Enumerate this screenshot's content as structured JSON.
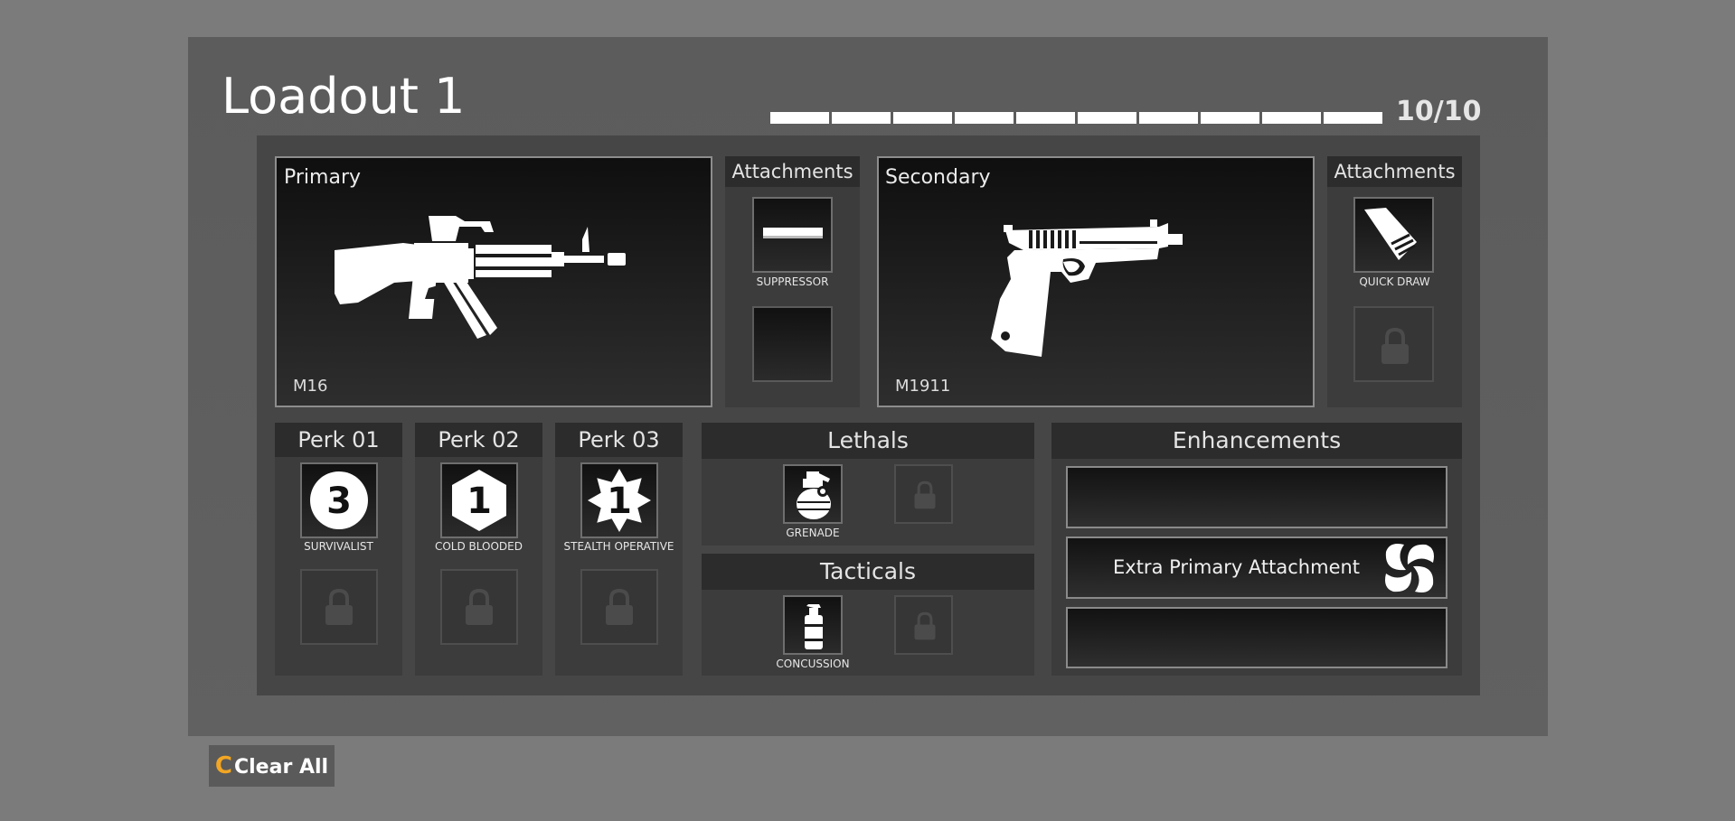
{
  "loadout": {
    "title": "Loadout 1",
    "points_used": 10,
    "points_max": 10,
    "points_label": "10/10"
  },
  "primary": {
    "label": "Primary",
    "weapon": "M16",
    "icon": "assault-rifle-icon",
    "attachments_header": "Attachments",
    "attachments": [
      {
        "name": "SUPPRESSOR",
        "icon": "suppressor-icon"
      },
      {
        "name": "",
        "icon": ""
      }
    ]
  },
  "secondary": {
    "label": "Secondary",
    "weapon": "M1911",
    "icon": "pistol-icon",
    "attachments_header": "Attachments",
    "attachments": [
      {
        "name": "QUICK DRAW",
        "icon": "quick-draw-icon"
      },
      {
        "name": "",
        "icon": "lock-icon",
        "locked": true
      }
    ]
  },
  "perks": [
    {
      "header": "Perk 01",
      "name": "SURVIVALIST",
      "badge": "3",
      "icon": "survivalist-icon"
    },
    {
      "header": "Perk 02",
      "name": "COLD BLOODED",
      "badge": "1",
      "icon": "cold-blooded-icon"
    },
    {
      "header": "Perk 03",
      "name": "STEALTH OPERATIVE",
      "badge": "1",
      "icon": "stealth-operative-icon"
    }
  ],
  "lethals": {
    "header": "Lethals",
    "items": [
      {
        "name": "GRENADE",
        "icon": "grenade-icon"
      }
    ]
  },
  "tacticals": {
    "header": "Tacticals",
    "items": [
      {
        "name": "CONCUSSION",
        "icon": "concussion-icon"
      }
    ]
  },
  "enhancements": {
    "header": "Enhancements",
    "slots": [
      {
        "label": ""
      },
      {
        "label": "Extra Primary Attachment",
        "icon": "pinwheel-icon"
      },
      {
        "label": ""
      }
    ]
  },
  "actions": {
    "clear_key": "C",
    "clear_label": "Clear All"
  },
  "colors": {
    "accent": "#f2a623",
    "text": "#ffffff"
  }
}
